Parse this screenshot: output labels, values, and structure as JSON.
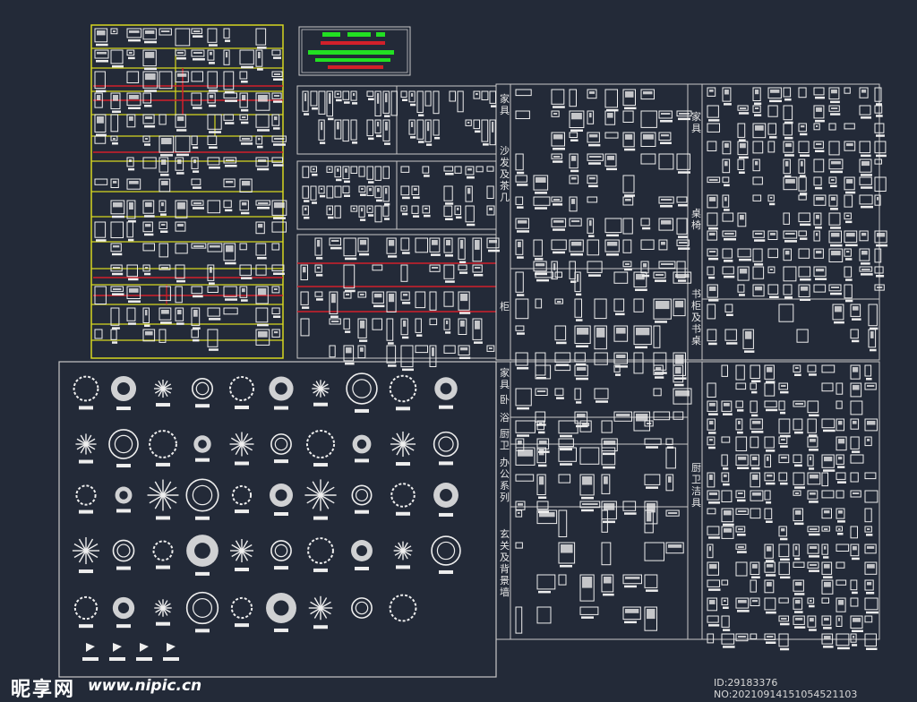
{
  "labels": {
    "furniture_a": "家具",
    "sofa": "沙发及茶几",
    "cabinet": "柜",
    "furniture_b": "家具",
    "table_chair": "桌椅",
    "bookcase": "书柜及书桌",
    "furniture_c": "家具",
    "bedroom": "卧",
    "restroom": "浴",
    "kitchen": "厨卫",
    "office": "办公系列",
    "entrance": "玄关及背景墙",
    "daily": "厨卫洁具"
  },
  "watermark": {
    "brand": "昵享网",
    "url": "www.nipic.cn",
    "id_text": "ID:29183376 NO:20210914151054521103"
  },
  "colors": {
    "background": "#232a38",
    "line": "#c8c8c8",
    "frame_yellow": "#d6d620",
    "red": "#d2202a",
    "green": "#22e022",
    "symbol": "#eeeeee"
  }
}
